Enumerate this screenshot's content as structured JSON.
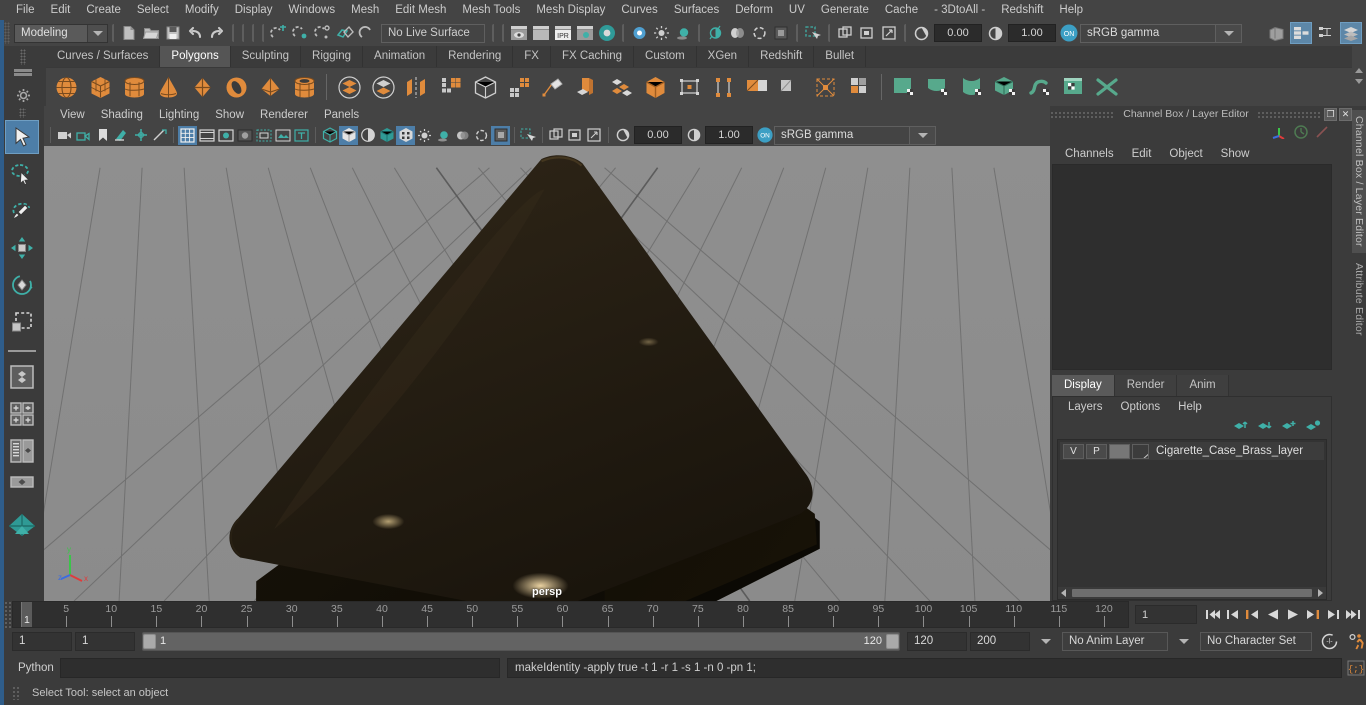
{
  "menubar": {
    "items": [
      "File",
      "Edit",
      "Create",
      "Select",
      "Modify",
      "Display",
      "Windows",
      "Mesh",
      "Edit Mesh",
      "Mesh Tools",
      "Mesh Display",
      "Curves",
      "Surfaces",
      "Deform",
      "UV",
      "Generate",
      "Cache",
      "- 3DtoAll -",
      "Redshift",
      "Help"
    ]
  },
  "statusline": {
    "mode": "Modeling",
    "live_surface": "No Live Surface",
    "num_left": "0.00",
    "num_right": "1.00",
    "gamma": "sRGB gamma",
    "icons": [
      "new-scene-icon",
      "open-scene-icon",
      "save-scene-icon",
      "undo-icon",
      "redo-icon",
      "select-by-hierarchy-icon",
      "select-by-object-icon",
      "select-by-component-icon",
      "snap-to-grid-icon",
      "snap-to-curve-icon",
      "snap-to-point-icon",
      "snap-to-plane-icon",
      "snap-to-view-plane-icon",
      "render-view-icon",
      "render-current-frame-icon",
      "ipr-render-icon",
      "render-settings-icon",
      "hypershade-icon"
    ],
    "right_icons": [
      "sidebar-toggle-icon",
      "attribute-editor-icon",
      "tool-settings-icon",
      "channel-box-icon"
    ]
  },
  "shelf": {
    "tabs": [
      "Curves / Surfaces",
      "Polygons",
      "Sculpting",
      "Rigging",
      "Animation",
      "Rendering",
      "FX",
      "FX Caching",
      "Custom",
      "XGen",
      "Redshift",
      "Bullet"
    ],
    "active_tab": "Polygons",
    "buttons": [
      "poly-sphere",
      "poly-cube",
      "poly-cylinder",
      "poly-cone",
      "poly-plane",
      "poly-torus",
      "poly-pyramid",
      "poly-pipe",
      "combine",
      "separate",
      "extract",
      "booleans",
      "smooth",
      "mirror",
      "bevel",
      "bridge",
      "multi-cut",
      "target-weld",
      "quad-draw",
      "insert-edge-loop",
      "offset-edge-loop",
      "crease",
      "uv-editor",
      "uv-planar",
      "uv-cylindrical",
      "uv-spherical",
      "uv-automatic",
      "uv-unfold",
      "uv-layout",
      "uv-snapshot"
    ]
  },
  "toolbox": {
    "items": [
      "select-tool",
      "lasso-select-tool",
      "paint-select-tool",
      "move-tool",
      "rotate-tool",
      "scale-tool",
      "last-tool-used",
      "quick-layout-single",
      "quick-layout-four",
      "quick-layout-outliner",
      "quick-layout-persp-graph",
      "quick-layout-hypershade",
      "quick-layout-persp"
    ],
    "selected": "select-tool"
  },
  "viewport": {
    "menu": [
      "View",
      "Shading",
      "Lighting",
      "Show",
      "Renderer",
      "Panels"
    ],
    "camera_label": "persp",
    "toolbar_icons": [
      "select-camera-icon",
      "lock-camera-icon",
      "bookmark-icon",
      "image-plane-icon",
      "2d-pan-zoom-icon",
      "oriented-bbox-icon",
      "grid-toggle-icon",
      "film-gate-icon",
      "resolution-gate-icon",
      "gate-mask-icon",
      "film-origin-icon",
      "safe-action-icon",
      "xray-icon",
      "wireframe-icon",
      "smooth-shade-icon",
      "shade-wireframe-icon",
      "textured-icon",
      "lighting-icon",
      "shadows-icon",
      "screen-space-ao-icon",
      "motion-blur-icon",
      "multisample-icon",
      "isolate-select-icon",
      "xray-joints-icon",
      "xray-active-icon",
      "exposure-icon",
      "gamma-icon",
      "color-management-icon"
    ]
  },
  "channelbox": {
    "title": "Channel Box / Layer Editor",
    "menu": [
      "Channels",
      "Edit",
      "Object",
      "Show"
    ],
    "restore_glyph": "❐",
    "close_glyph": "✕"
  },
  "layer_editor": {
    "tabs": [
      "Display",
      "Render",
      "Anim"
    ],
    "active_tab": "Display",
    "menu": [
      "Layers",
      "Options",
      "Help"
    ],
    "layers": [
      {
        "visibility": "V",
        "playback": "P",
        "shading": "",
        "name": "Cigarette_Case_Brass_layer"
      }
    ]
  },
  "sidetabs": {
    "items": [
      "Channel Box / Layer Editor",
      "Attribute Editor"
    ]
  },
  "timeline": {
    "ticks": [
      5,
      10,
      15,
      20,
      25,
      30,
      35,
      40,
      45,
      50,
      55,
      60,
      65,
      70,
      75,
      80,
      85,
      90,
      95,
      100,
      105,
      110,
      115,
      120
    ],
    "current_frame": "1",
    "current_frame_field": "1",
    "playback_buttons": [
      "go-to-start",
      "step-back-key",
      "step-back-frame",
      "play-backwards",
      "play-forwards",
      "step-forward-frame",
      "step-forward-key",
      "go-to-end"
    ]
  },
  "range": {
    "start": "1",
    "anim_start": "1",
    "range_start_label": "1",
    "range_end_label": "120",
    "anim_end": "120",
    "end": "200",
    "anim_layer": "No Anim Layer",
    "character_set": "No Character Set",
    "right_icons": [
      "auto-keyframe-icon",
      "animation-preferences-icon"
    ]
  },
  "command": {
    "label": "Python",
    "input_value": "",
    "output": "makeIdentity -apply true -t 1 -r 1 -s 1 -n 0 -pn 1;",
    "script_editor_icon": "script-editor-icon"
  },
  "helpline": {
    "text": "Select Tool: select an object"
  },
  "colors": {
    "accent_orange": "#e08b3c",
    "accent_teal": "#3fa9a0",
    "accent_blue": "#4d7ea8",
    "bg": "#444444",
    "panel": "#3b3b3b",
    "field": "#2e2e2e"
  }
}
